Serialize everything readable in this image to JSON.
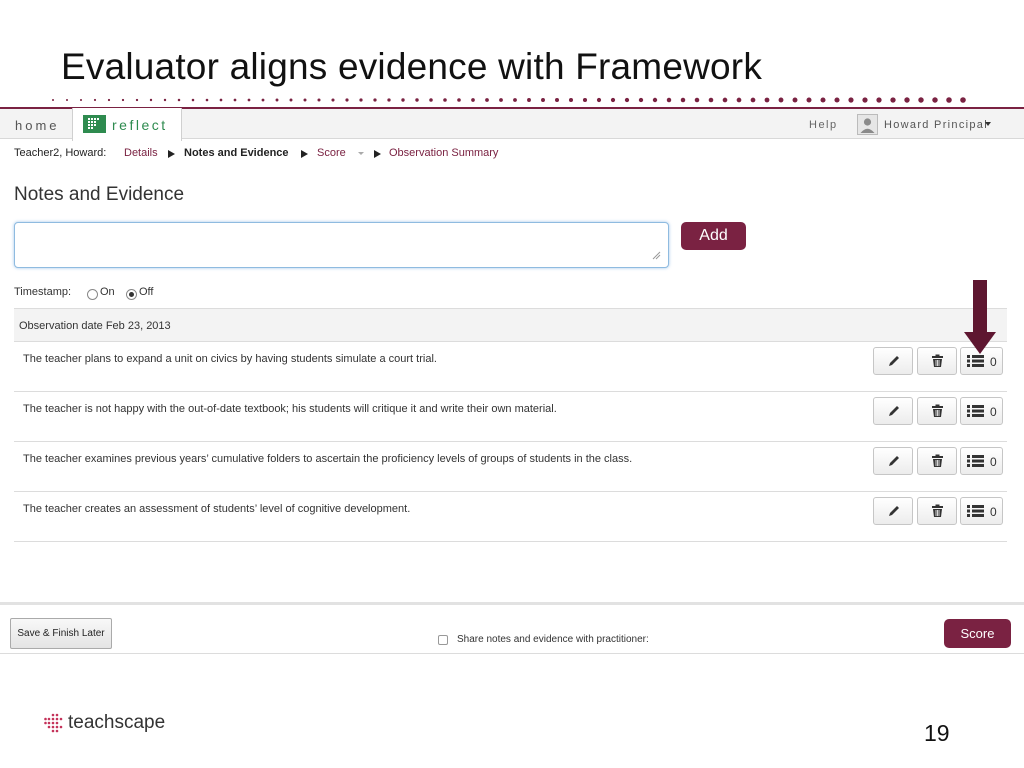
{
  "slide": {
    "title": "Evaluator aligns evidence with Framework",
    "page_number": "19",
    "footer_logo": "teachscape"
  },
  "nav": {
    "home_label": "home",
    "reflect_label": "reflect",
    "help_label": "Help",
    "user_name": "Howard Principal"
  },
  "breadcrumb": {
    "teacher": "Teacher2, Howard:",
    "details": "Details",
    "notes": "Notes and Evidence",
    "score": "Score",
    "summary": "Observation Summary"
  },
  "main": {
    "section_title": "Notes and Evidence",
    "note_input_value": "",
    "add_label": "Add",
    "timestamp_label": "Timestamp:",
    "timestamp_on": "On",
    "timestamp_off": "Off",
    "timestamp_selected": "Off",
    "observation_date": "Observation date Feb 23, 2013"
  },
  "notes": [
    {
      "text": "The teacher plans to expand a unit on civics by having students simulate a court trial.",
      "link_count": "0"
    },
    {
      "text": "The teacher is not happy with the out-of-date textbook; his students will critique it and write their own material.",
      "link_count": "0"
    },
    {
      "text": "The teacher examines previous years’ cumulative folders to ascertain the proficiency levels of groups of students in the class.",
      "link_count": "0"
    },
    {
      "text": "The teacher creates an assessment of students’ level of cognitive development.",
      "link_count": "0"
    }
  ],
  "footer": {
    "save_label": "Save & Finish Later",
    "share_label": "Share notes and evidence with practitioner:",
    "share_checked": false,
    "score_label": "Score"
  },
  "colors": {
    "brand": "#7a2242",
    "reflect_green": "#2e8b4f"
  },
  "icons": [
    "pencil-icon",
    "trash-icon",
    "list-icon",
    "user-icon",
    "caret-down-icon",
    "arrow-down-icon"
  ]
}
